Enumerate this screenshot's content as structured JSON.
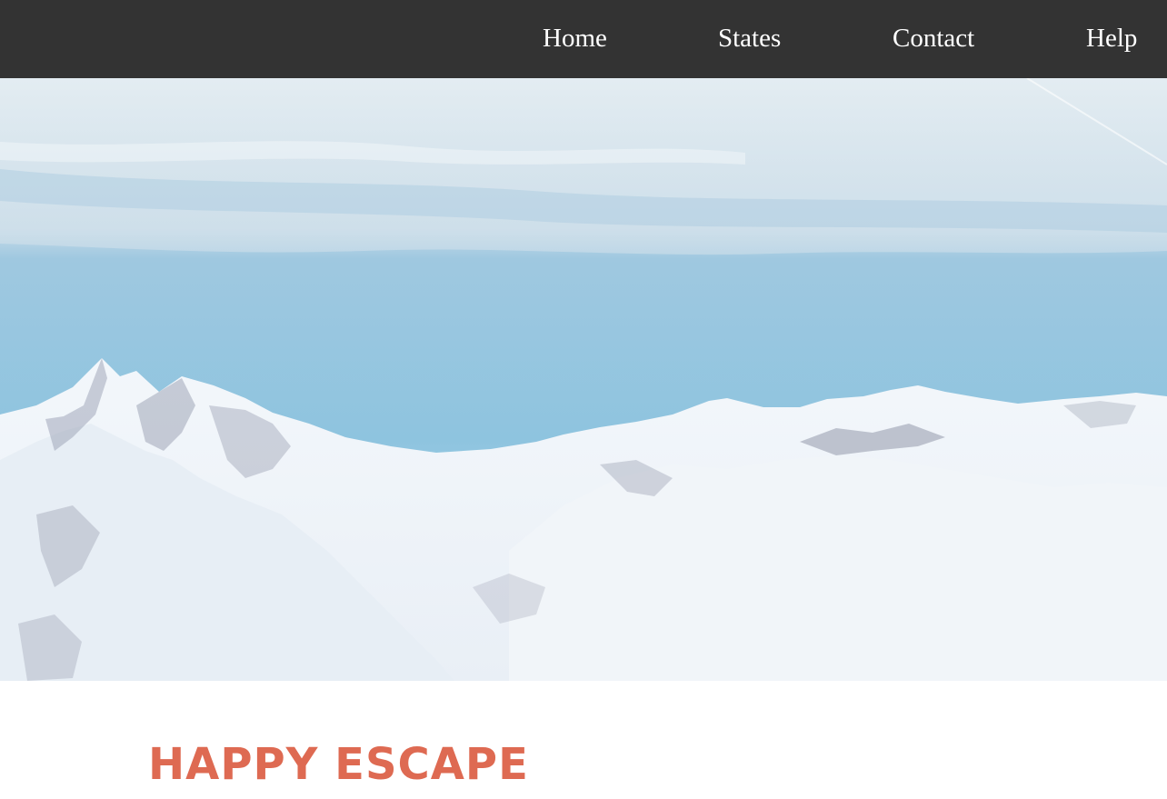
{
  "nav": {
    "links": [
      {
        "label": "Home"
      },
      {
        "label": "States"
      },
      {
        "label": "Contact"
      },
      {
        "label": "Help"
      }
    ]
  },
  "hero": {
    "image": "snowy-mountain-range"
  },
  "main": {
    "headline": "HAPPY ESCAPE"
  },
  "colors": {
    "navbar_bg": "#333333",
    "nav_text": "#ffffff",
    "headline": "#de6a52",
    "page_bg": "#ffffff"
  }
}
